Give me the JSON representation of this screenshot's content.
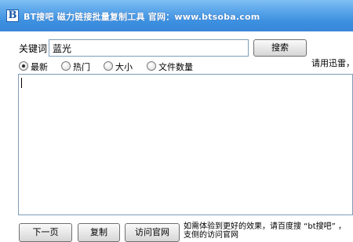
{
  "window": {
    "icon_letter": "B",
    "title": "BT搜吧 磁力链接批量复制工具 官网：www.btsoba.com"
  },
  "search": {
    "label": "关键词",
    "value": "蓝光",
    "button": "搜索"
  },
  "sort_options": [
    {
      "label": "最新",
      "checked": true
    },
    {
      "label": "热门",
      "checked": false
    },
    {
      "label": "大小",
      "checked": false
    },
    {
      "label": "文件数量",
      "checked": false
    }
  ],
  "hint": "请用迅雷，",
  "results": {
    "text": ""
  },
  "actions": {
    "next_page": "下一页",
    "copy": "复制",
    "visit_site": "访问官网"
  },
  "note": "如需体验到更好的效果，请百度搜 “bt搜吧” ，支侧的访问官网"
}
